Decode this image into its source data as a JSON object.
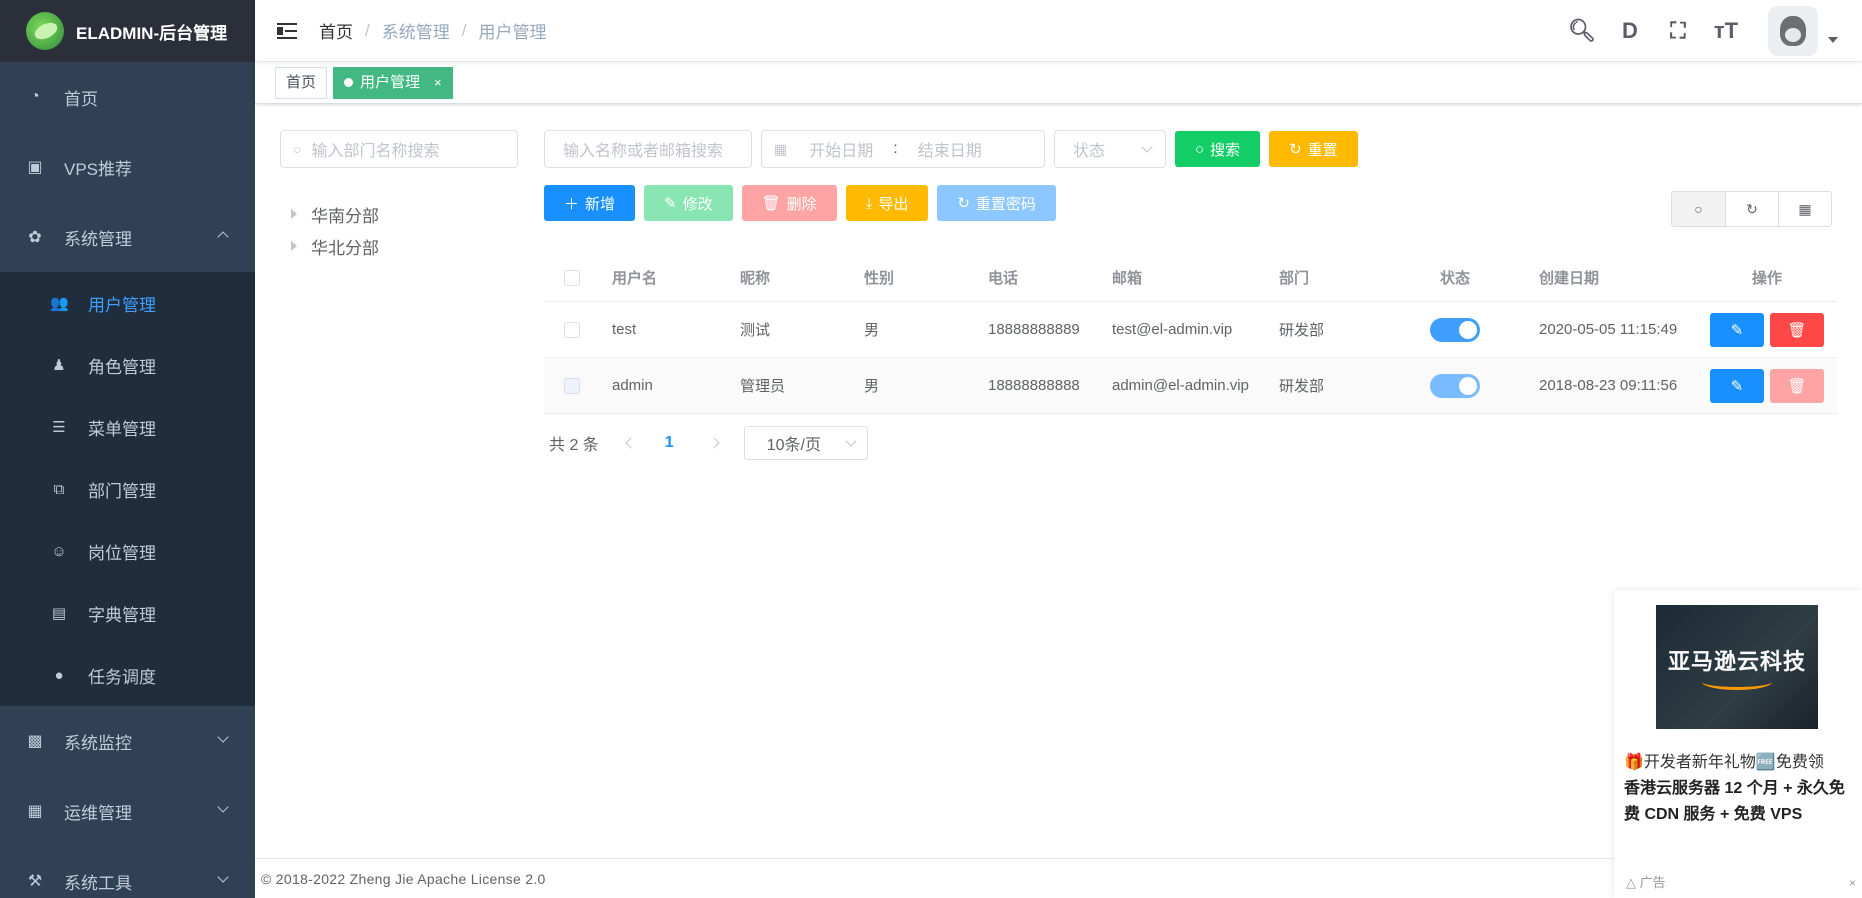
{
  "app": {
    "title": "ELADMIN-后台管理"
  },
  "sidebar": {
    "items": [
      {
        "label": "首页",
        "icon": "dashboard-icon"
      },
      {
        "label": "VPS推荐",
        "icon": "server-icon"
      },
      {
        "label": "系统管理",
        "icon": "gear-icon",
        "expanded": true
      },
      {
        "label": "系统监控",
        "icon": "monitor-icon"
      },
      {
        "label": "运维管理",
        "icon": "ops-icon"
      },
      {
        "label": "系统工具",
        "icon": "tools-icon"
      }
    ],
    "sub_items": [
      {
        "label": "用户管理",
        "icon": "user-icon",
        "active": true
      },
      {
        "label": "角色管理",
        "icon": "role-icon"
      },
      {
        "label": "菜单管理",
        "icon": "menu-icon"
      },
      {
        "label": "部门管理",
        "icon": "dept-icon"
      },
      {
        "label": "岗位管理",
        "icon": "post-icon"
      },
      {
        "label": "字典管理",
        "icon": "dict-icon"
      },
      {
        "label": "任务调度",
        "icon": "timer-icon"
      }
    ]
  },
  "breadcrumb": {
    "home": "首页",
    "sep": "/",
    "level1": "系统管理",
    "level2": "用户管理"
  },
  "tags": {
    "home": "首页",
    "active": "用户管理",
    "close": "×"
  },
  "dept": {
    "search_placeholder": "输入部门名称搜索",
    "nodes": [
      "华南分部",
      "华北分部"
    ]
  },
  "filters": {
    "name_placeholder": "输入名称或者邮箱搜索",
    "start_date": "开始日期",
    "date_sep": ":",
    "end_date": "结束日期",
    "status_placeholder": "状态",
    "search_label": "搜索",
    "reset_label": "重置"
  },
  "toolbar": {
    "add": "新增",
    "edit": "修改",
    "delete": "删除",
    "export": "导出",
    "reset_pwd": "重置密码"
  },
  "table": {
    "columns": [
      "用户名",
      "昵称",
      "性别",
      "电话",
      "邮箱",
      "部门",
      "状态",
      "创建日期",
      "操作"
    ],
    "rows": [
      {
        "username": "test",
        "nickname": "测试",
        "gender": "男",
        "phone": "18888888889",
        "email": "test@el-admin.vip",
        "dept": "研发部",
        "enabled": true,
        "created": "2020-05-05 11:15:49"
      },
      {
        "username": "admin",
        "nickname": "管理员",
        "gender": "男",
        "phone": "18888888888",
        "email": "admin@el-admin.vip",
        "dept": "研发部",
        "enabled": true,
        "created": "2018-08-23 09:11:56"
      }
    ]
  },
  "pagination": {
    "total": "共 2 条",
    "current": "1",
    "page_size": "10条/页"
  },
  "footer": {
    "text": "© 2018-2022 Zheng Jie Apache License 2.0"
  },
  "ad": {
    "image_text": "亚马逊云科技",
    "line1": "🎁开发者新年礼物🆓免费领",
    "line2": "香港云服务器 12 个月 + 永久免费 CDN 服务 + 免费 VPS",
    "label": "广告",
    "close": "×"
  },
  "colors": {
    "sidebar_bg": "#304156",
    "primary": "#1890ff",
    "success": "#13ce66",
    "warning": "#ffba00",
    "danger": "#ff4949",
    "tag_active": "#42b983"
  }
}
